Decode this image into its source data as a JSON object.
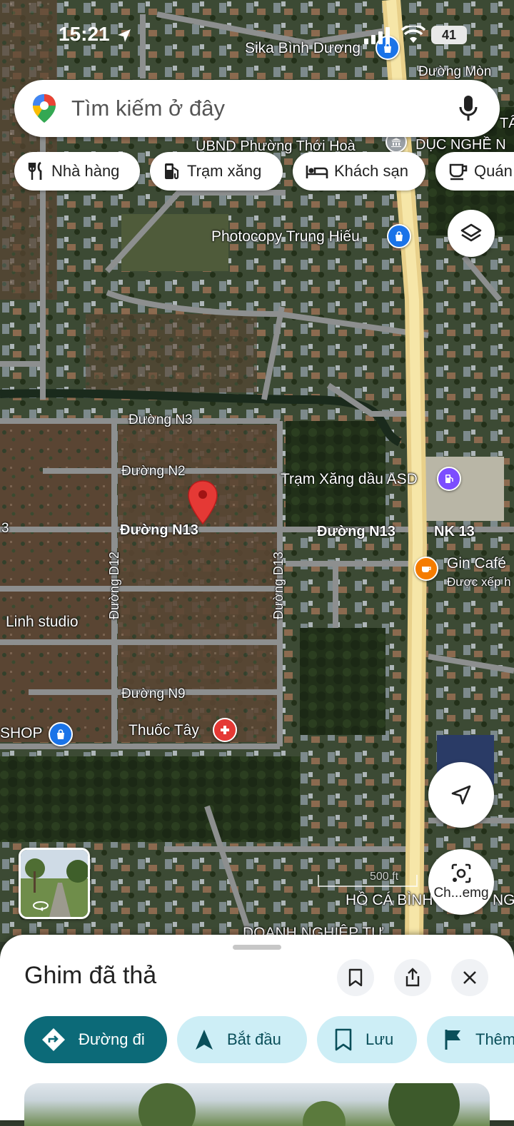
{
  "status_bar": {
    "time": "15:21",
    "battery": "41"
  },
  "search": {
    "placeholder": "Tìm kiếm ở đây"
  },
  "chips": [
    {
      "label": "Nhà hàng",
      "icon": "restaurant-icon"
    },
    {
      "label": "Trạm xăng",
      "icon": "gas-station-icon"
    },
    {
      "label": "Khách sạn",
      "icon": "hotel-icon"
    },
    {
      "label": "Quán",
      "icon": "cafe-icon"
    }
  ],
  "map_labels": {
    "sika": "Sika Bình Dương",
    "duong_mon": "Đường Mòn",
    "ubnd": "UBND Phường Thới Hoà",
    "duc_nghe": "DỤC NGHỀ N",
    "ta": "TÂ",
    "photocopy": "Photocopy Trung Hiếu",
    "n3": "Đường N3",
    "n2": "Đường N2",
    "tram_xang": "Trạm Xăng dầu ASD",
    "n13_left": "Đường N13",
    "n13_right": "Đường N13",
    "nk13": "NK 13",
    "gin_cafe": "Gin Café",
    "gin_cafe_sub": "Được xếp h",
    "d12": "Đường D12",
    "d13": "Đường D13",
    "linh": "Linh studio",
    "n9": "Đường N9",
    "shop": "SHOP",
    "thuoc_tay": "Thuốc Tây",
    "scale": "500 ft",
    "ho_ca": "HỒ CÁ BÌNH",
    "ho_ca_tail": "NG",
    "doanh_nghiep": "DOANH NGHIỆP TƯ",
    "left_edge": "3"
  },
  "lens_button": {
    "label": "Ch...emg"
  },
  "colors": {
    "accent": "#0c6a78",
    "secondary_chip": "#cdeef6",
    "pin_red": "#e53935",
    "poi_blue": "#1a73e8",
    "poi_orange": "#f57c00",
    "poi_purple": "#7c4dff",
    "highway": "#f1d98a"
  },
  "sheet": {
    "title": "Ghim đã thả",
    "actions": [
      {
        "label": "Đường đi",
        "icon": "directions-icon"
      },
      {
        "label": "Bắt đầu",
        "icon": "navigation-arrow-icon"
      },
      {
        "label": "Lưu",
        "icon": "bookmark-icon"
      },
      {
        "label": "Thêm",
        "icon": "flag-icon"
      }
    ]
  }
}
